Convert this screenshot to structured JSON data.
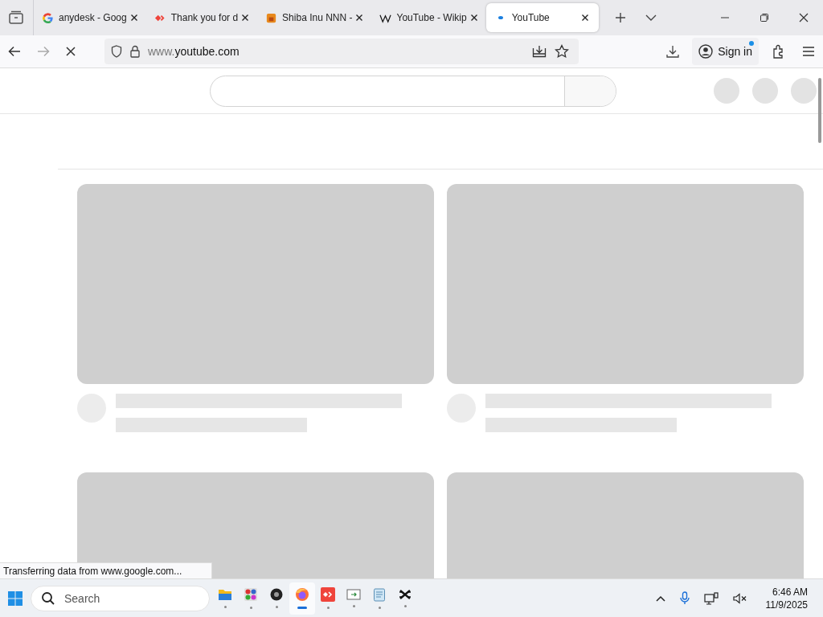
{
  "tabs": [
    {
      "title": "anydesk - Goog",
      "kind": "google",
      "selected": false
    },
    {
      "title": "Thank you for d",
      "kind": "anydesk",
      "selected": false
    },
    {
      "title": "Shiba Inu NNN -",
      "kind": "shiba",
      "selected": false
    },
    {
      "title": "YouTube - Wikip",
      "kind": "wikipedia",
      "selected": false
    },
    {
      "title": "YouTube",
      "kind": "loading",
      "selected": true
    }
  ],
  "address_bar": {
    "host_prefix": "www.",
    "host": "youtube.com"
  },
  "sign_in": {
    "label": "Sign in",
    "notification": true
  },
  "status_text": "Transferring data from www.google.com...",
  "taskbar": {
    "search_placeholder": "Search",
    "apps": [
      {
        "kind": "folder",
        "selected": false
      },
      {
        "kind": "grid",
        "selected": false
      },
      {
        "kind": "disc",
        "selected": false
      },
      {
        "kind": "firefox",
        "selected": true
      },
      {
        "kind": "anydesk",
        "selected": false
      },
      {
        "kind": "window",
        "selected": false
      },
      {
        "kind": "notepad",
        "selected": false
      },
      {
        "kind": "capcut",
        "selected": false
      }
    ],
    "time": "6:46 AM",
    "date": "11/9/2025"
  }
}
